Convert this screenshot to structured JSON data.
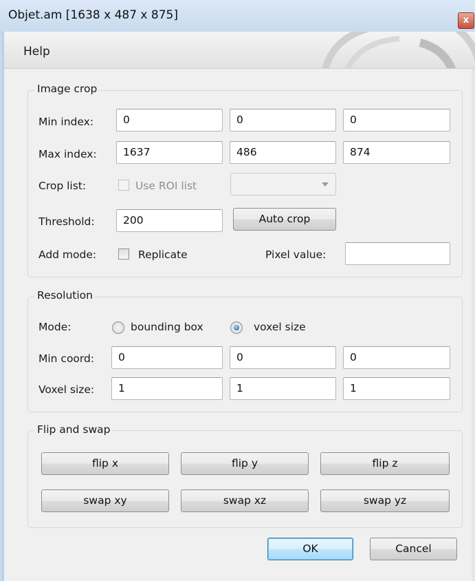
{
  "window": {
    "title": "Objet.am [1638 x 487 x 875]",
    "close_glyph": "x"
  },
  "menu": {
    "help": "Help"
  },
  "image_crop": {
    "group_title": "Image crop",
    "min_index_label": "Min index:",
    "min_index": [
      "0",
      "0",
      "0"
    ],
    "max_index_label": "Max index:",
    "max_index": [
      "1637",
      "486",
      "874"
    ],
    "crop_list_label": "Crop list:",
    "use_roi_label": "Use ROI list",
    "use_roi_checked": false,
    "use_roi_enabled": false,
    "roi_select_value": "",
    "threshold_label": "Threshold:",
    "threshold": "200",
    "auto_crop_label": "Auto crop",
    "add_mode_label": "Add mode:",
    "replicate_label": "Replicate",
    "replicate_checked": false,
    "pixel_value_label": "Pixel value:",
    "pixel_value": ""
  },
  "resolution": {
    "group_title": "Resolution",
    "mode_label": "Mode:",
    "bounding_box_label": "bounding box",
    "voxel_size_option_label": "voxel size",
    "selected_mode": "voxel size",
    "min_coord_label": "Min coord:",
    "min_coord": [
      "0",
      "0",
      "0"
    ],
    "voxel_size_label": "Voxel size:",
    "voxel_size": [
      "1",
      "1",
      "1"
    ]
  },
  "flip_swap": {
    "group_title": "Flip and swap",
    "buttons": [
      "flip x",
      "flip y",
      "flip z",
      "swap xy",
      "swap xz",
      "swap yz"
    ]
  },
  "footer": {
    "ok": "OK",
    "cancel": "Cancel"
  }
}
